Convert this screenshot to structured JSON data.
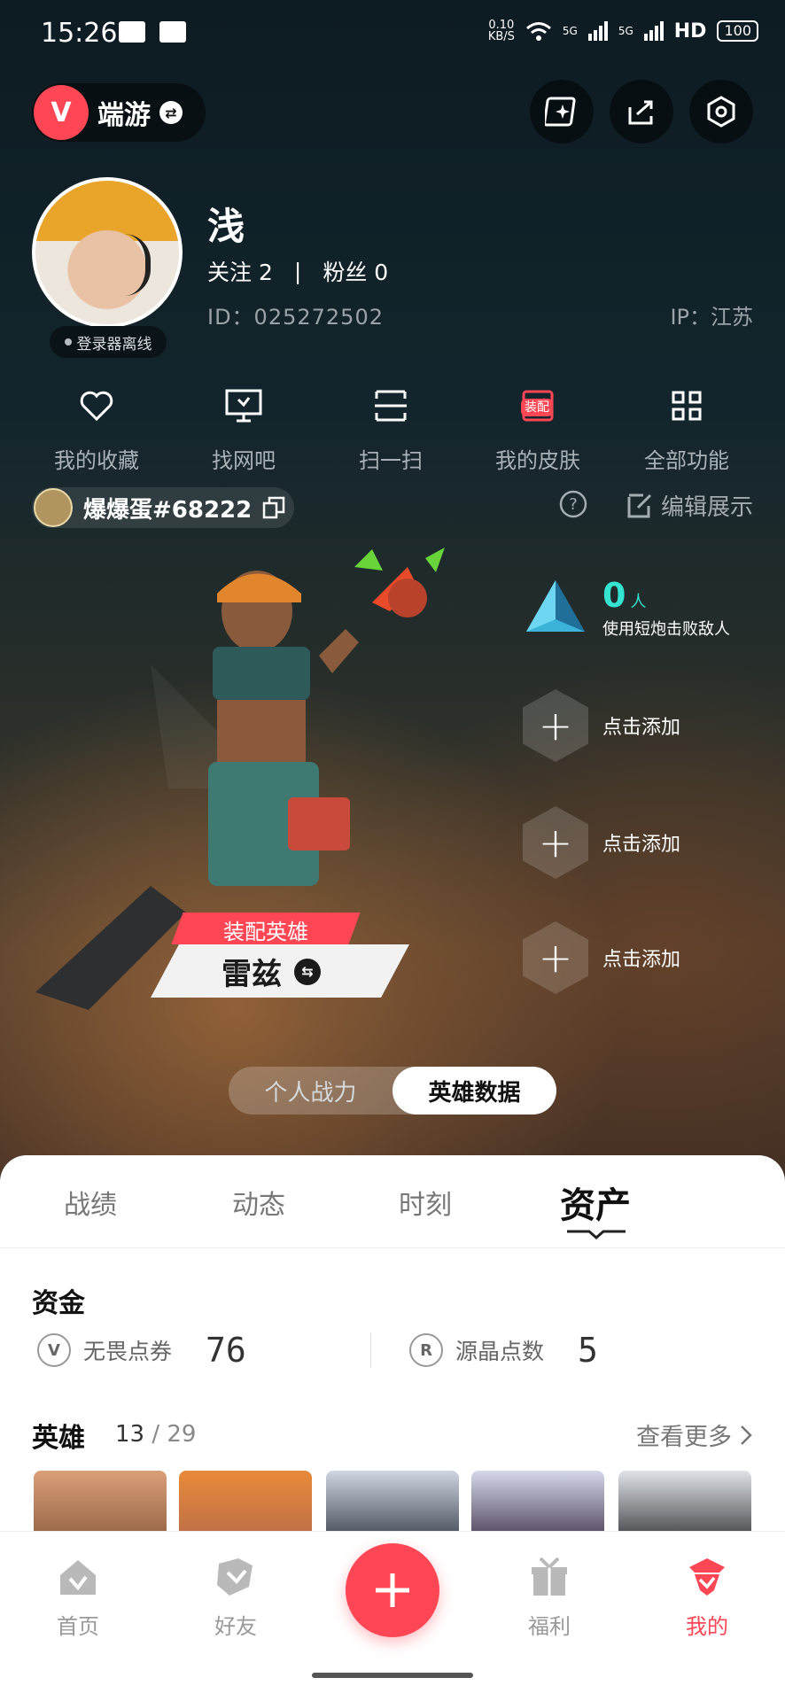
{
  "status_bar": {
    "time": "15:26",
    "net_speed_top": "0.10",
    "net_speed_bottom": "KB/S",
    "sim1": "5G",
    "sim2": "5G",
    "hd": "HD",
    "battery": "100"
  },
  "header": {
    "game_name": "端游",
    "game_logo_letter": "V"
  },
  "profile": {
    "username": "浅",
    "follow_label": "关注",
    "follow_count": "2",
    "fans_label": "粉丝",
    "fans_count": "0",
    "id_text": "ID：025272502",
    "ip_text": "IP：江苏",
    "login_status": "登录器离线"
  },
  "quick_actions": [
    {
      "label": "我的收藏",
      "icon": "heart-icon"
    },
    {
      "label": "找网吧",
      "icon": "monitor-icon"
    },
    {
      "label": "扫一扫",
      "icon": "scan-icon"
    },
    {
      "label": "我的皮肤",
      "icon": "skin-icon",
      "badge": "装配"
    },
    {
      "label": "全部功能",
      "icon": "grid-icon"
    }
  ],
  "riot": {
    "name": "爆爆蛋#68222",
    "edit_label": "编辑展示"
  },
  "agent": {
    "equip_label": "装配英雄",
    "name": "雷兹"
  },
  "stats": {
    "kill_count": "0",
    "kill_unit": "人",
    "kill_desc": "使用短炮击败敌人",
    "add_slots": [
      "点击添加",
      "点击添加",
      "点击添加"
    ]
  },
  "segment": {
    "options": [
      "个人战力",
      "英雄数据"
    ],
    "selected": "英雄数据"
  },
  "tabs": {
    "items": [
      "战绩",
      "动态",
      "时刻",
      "资产"
    ],
    "active": "资产"
  },
  "funds": {
    "title": "资金",
    "items": [
      {
        "icon": "valorant-points-icon",
        "label": "无畏点券",
        "value": "76"
      },
      {
        "icon": "radianite-icon",
        "label": "源晶点数",
        "value": "5"
      }
    ]
  },
  "heroes": {
    "title": "英雄",
    "owned": "13",
    "total": "29",
    "see_more": "查看更多"
  },
  "bottom_nav": [
    {
      "label": "首页",
      "icon": "home-icon"
    },
    {
      "label": "好友",
      "icon": "friends-icon"
    },
    {
      "label": "福利",
      "icon": "gift-icon"
    },
    {
      "label": "我的",
      "icon": "me-icon"
    }
  ],
  "colors": {
    "accent": "#ff4655",
    "kill_teal": "#34e3d0"
  }
}
